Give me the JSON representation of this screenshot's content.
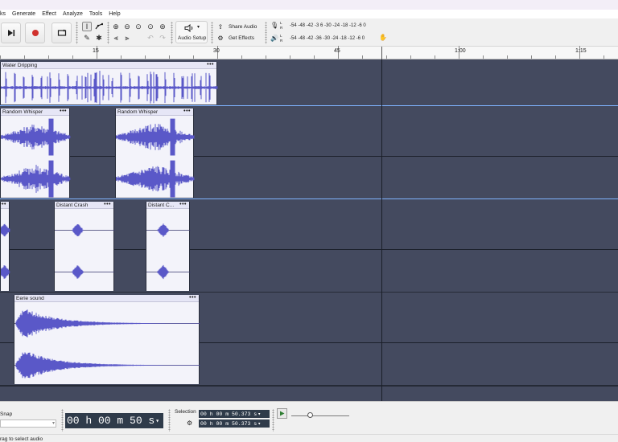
{
  "menu": [
    "ks",
    "Generate",
    "Effect",
    "Analyze",
    "Tools",
    "Help"
  ],
  "toolbar": {
    "audio_setup_label": "Audio Setup",
    "share_audio_label": "Share Audio",
    "get_effects_label": "Get Effects",
    "record_meter_scale": "-54  -48  -42  -3 6  -30  -24  -18  -12   -6    0",
    "play_meter_scale": "-54  -48  -42  -36  -30  -24  -18  -12   -6    0",
    "meter_lr": "L\nR"
  },
  "ruler": {
    "labels": [
      {
        "text": "15",
        "t": 15
      },
      {
        "text": "30",
        "t": 30
      },
      {
        "text": "45",
        "t": 45
      },
      {
        "text": "1:00",
        "t": 60
      },
      {
        "text": "1:15",
        "t": 75
      }
    ]
  },
  "tracks": [
    {
      "clips": [
        {
          "name": "Water Dripping"
        }
      ]
    },
    {
      "clips": [
        {
          "name": "Random Whisper"
        },
        {
          "name": "Random Whisper"
        }
      ]
    },
    {
      "clips": [
        {
          "name": ""
        },
        {
          "name": "Distant Crash"
        },
        {
          "name": "Distant C..."
        }
      ]
    },
    {
      "clips": [
        {
          "name": "Eerie sound"
        }
      ]
    }
  ],
  "bottom": {
    "snap_label": "Snap",
    "snap_value": "",
    "time_display": "00 h 00 m 50 s",
    "selection_label": "Selection",
    "selection_start": "00 h 00 m 50.373 s",
    "selection_end": "00 h 00 m 50.373 s"
  },
  "status": {
    "text": "rag to select audio"
  },
  "colors": {
    "accent": "#5a58c8",
    "track_bg": "#444a5f",
    "clip_bg": "#f3f3fa",
    "record": "#d0312d"
  }
}
